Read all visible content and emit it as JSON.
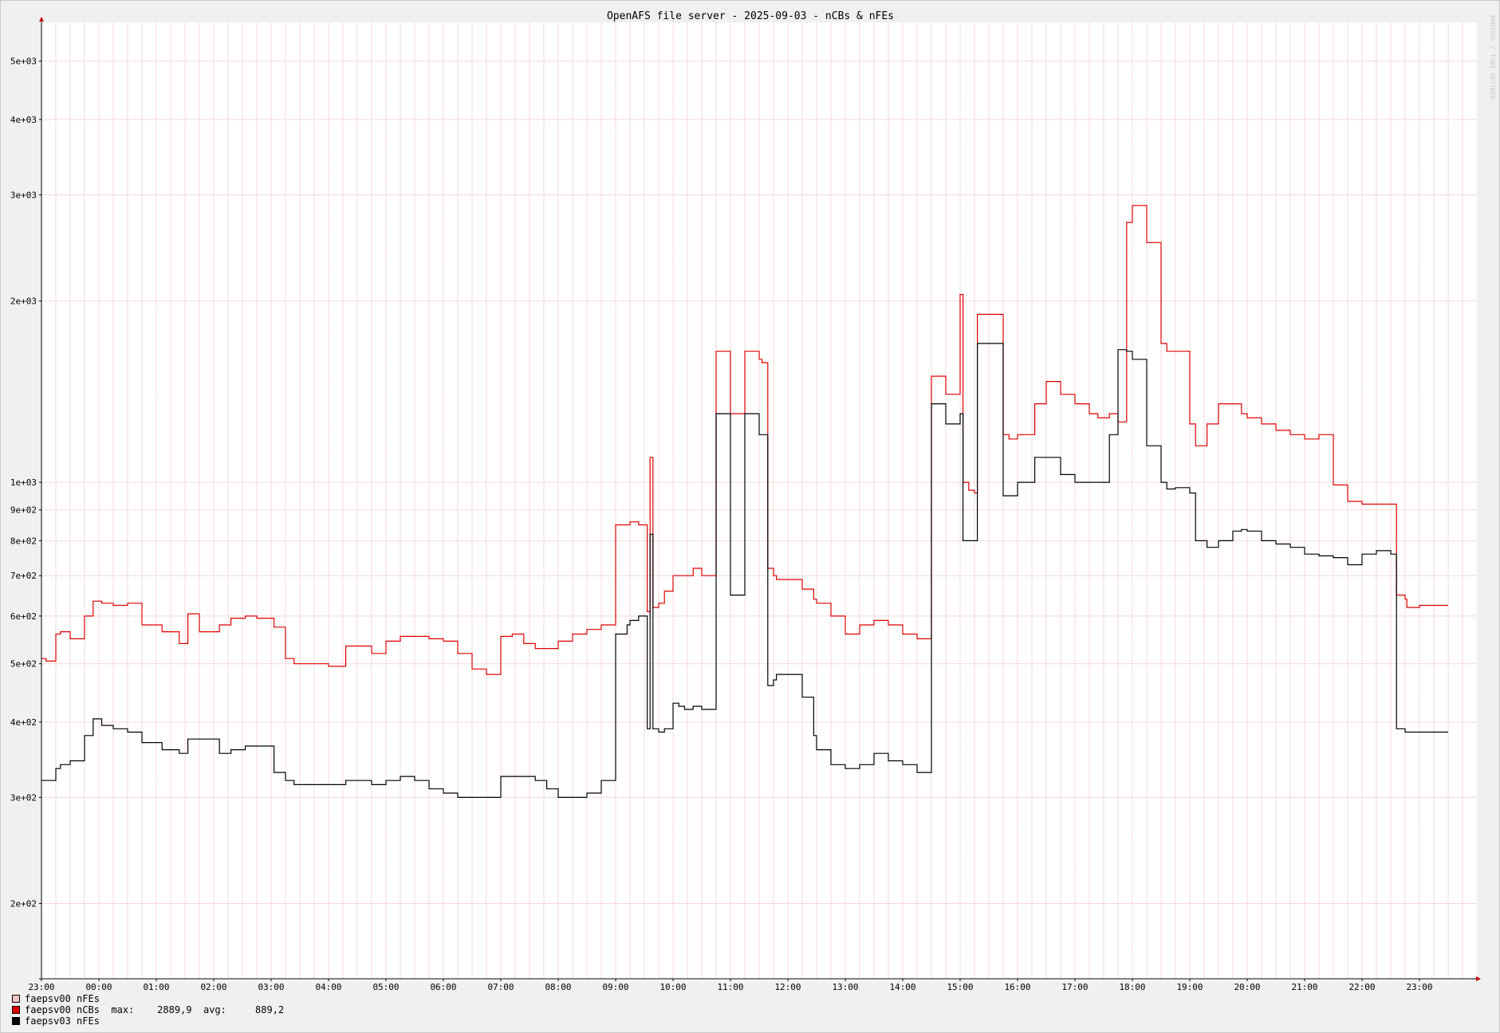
{
  "watermark": "RRDTOOL / TOBI OETIKER",
  "chart_data": {
    "type": "line",
    "title": "OpenAFS file server - 2025-09-03 - nCBs & nFEs",
    "y_scale": "log",
    "ylim": [
      150,
      5800
    ],
    "y_ticks": [
      {
        "value": 200,
        "label": "2e+02"
      },
      {
        "value": 300,
        "label": "3e+02"
      },
      {
        "value": 400,
        "label": "4e+02"
      },
      {
        "value": 500,
        "label": "5e+02"
      },
      {
        "value": 600,
        "label": "6e+02"
      },
      {
        "value": 700,
        "label": "7e+02"
      },
      {
        "value": 800,
        "label": "8e+02"
      },
      {
        "value": 900,
        "label": "9e+02"
      },
      {
        "value": 1000,
        "label": "1e+03"
      },
      {
        "value": 2000,
        "label": "2e+03"
      },
      {
        "value": 3000,
        "label": "3e+03"
      },
      {
        "value": 4000,
        "label": "4e+03"
      },
      {
        "value": 5000,
        "label": "5e+03"
      }
    ],
    "x_unit": "hours from 23:00",
    "xlim": [
      0,
      25
    ],
    "x_ticks": [
      "23:00",
      "00:00",
      "01:00",
      "02:00",
      "03:00",
      "04:00",
      "05:00",
      "06:00",
      "07:00",
      "08:00",
      "09:00",
      "10:00",
      "11:00",
      "12:00",
      "13:00",
      "14:00",
      "15:00",
      "16:00",
      "17:00",
      "18:00",
      "19:00",
      "20:00",
      "21:00",
      "22:00",
      "23:00"
    ],
    "grid": true,
    "legend_position": "bottom-left",
    "series": [
      {
        "name": "faepsv00 nFEs",
        "color": "#f4c4c4",
        "x": [],
        "values": []
      },
      {
        "name": "faepsv00 nCBs",
        "color": "#e00000",
        "stats": {
          "max_label": "max:",
          "max": "2889,9",
          "avg_label": "avg:",
          "avg": "889,2"
        },
        "x": [
          0.0,
          0.08,
          0.25,
          0.33,
          0.5,
          0.75,
          0.9,
          1.05,
          1.25,
          1.5,
          1.75,
          2.1,
          2.4,
          2.55,
          2.75,
          3.1,
          3.3,
          3.55,
          3.75,
          4.05,
          4.25,
          4.4,
          4.75,
          5.0,
          5.3,
          5.55,
          5.75,
          6.0,
          6.25,
          6.5,
          6.75,
          7.0,
          7.25,
          7.5,
          7.75,
          8.0,
          8.2,
          8.4,
          8.6,
          8.8,
          9.0,
          9.25,
          9.5,
          9.75,
          10.0,
          10.2,
          10.25,
          10.4,
          10.55,
          10.6,
          10.65,
          10.75,
          10.85,
          11.0,
          11.1,
          11.2,
          11.35,
          11.5,
          11.75,
          12.0,
          12.25,
          12.5,
          12.55,
          12.65,
          12.75,
          12.8,
          13.0,
          13.25,
          13.45,
          13.5,
          13.75,
          14.0,
          14.25,
          14.5,
          14.75,
          15.0,
          15.25,
          15.5,
          15.75,
          16.0,
          16.05,
          16.15,
          16.25,
          16.3,
          16.35,
          16.5,
          16.75,
          16.85,
          17.0,
          17.3,
          17.5,
          17.75,
          18.0,
          18.25,
          18.4,
          18.6,
          18.75,
          18.9,
          19.0,
          19.25,
          19.5,
          19.6,
          19.75,
          20.0,
          20.1,
          20.3,
          20.5,
          20.75,
          20.9,
          21.0,
          21.25,
          21.5,
          21.75,
          22.0,
          22.25,
          22.5,
          22.75,
          23.0,
          23.25,
          23.5,
          23.6,
          23.75,
          23.78,
          24.0
        ],
        "values": [
          510,
          505,
          560,
          565,
          550,
          600,
          635,
          630,
          625,
          630,
          580,
          565,
          540,
          605,
          565,
          580,
          595,
          600,
          595,
          575,
          510,
          500,
          500,
          495,
          535,
          535,
          520,
          545,
          555,
          555,
          550,
          545,
          520,
          490,
          480,
          555,
          560,
          540,
          530,
          530,
          545,
          560,
          570,
          580,
          850,
          850,
          860,
          850,
          610,
          1100,
          620,
          630,
          660,
          700,
          700,
          700,
          720,
          700,
          1650,
          1300,
          1650,
          1600,
          1580,
          720,
          700,
          690,
          690,
          665,
          640,
          630,
          600,
          560,
          580,
          590,
          580,
          560,
          550,
          1500,
          1400,
          2050,
          1000,
          970,
          960,
          1900,
          1900,
          1900,
          1200,
          1180,
          1200,
          1350,
          1470,
          1400,
          1350,
          1300,
          1280,
          1300,
          1260,
          2700,
          2880,
          2500,
          1700,
          1650,
          1650,
          1250,
          1150,
          1250,
          1350,
          1350,
          1300,
          1280,
          1250,
          1220,
          1200,
          1180,
          1200,
          990,
          930,
          920,
          920,
          920,
          650,
          640,
          620,
          625
        ]
      },
      {
        "name": "faepsv03 nFEs",
        "color": "#000000",
        "x": [
          0.0,
          0.08,
          0.25,
          0.33,
          0.5,
          0.75,
          0.9,
          1.05,
          1.25,
          1.5,
          1.75,
          2.1,
          2.4,
          2.55,
          2.75,
          3.1,
          3.3,
          3.55,
          3.75,
          4.05,
          4.25,
          4.4,
          4.75,
          5.0,
          5.3,
          5.55,
          5.75,
          6.0,
          6.25,
          6.5,
          6.75,
          7.0,
          7.25,
          7.5,
          7.75,
          8.0,
          8.2,
          8.4,
          8.6,
          8.8,
          9.0,
          9.25,
          9.5,
          9.75,
          10.0,
          10.2,
          10.25,
          10.4,
          10.55,
          10.6,
          10.65,
          10.75,
          10.85,
          11.0,
          11.1,
          11.2,
          11.35,
          11.5,
          11.75,
          12.0,
          12.25,
          12.5,
          12.55,
          12.65,
          12.75,
          12.8,
          13.0,
          13.25,
          13.45,
          13.5,
          13.75,
          14.0,
          14.25,
          14.5,
          14.75,
          15.0,
          15.25,
          15.5,
          15.75,
          16.0,
          16.05,
          16.15,
          16.25,
          16.3,
          16.35,
          16.5,
          16.75,
          16.85,
          17.0,
          17.3,
          17.5,
          17.75,
          18.0,
          18.25,
          18.4,
          18.6,
          18.75,
          18.9,
          19.0,
          19.25,
          19.5,
          19.6,
          19.75,
          20.0,
          20.1,
          20.3,
          20.5,
          20.75,
          20.9,
          21.0,
          21.25,
          21.5,
          21.75,
          22.0,
          22.25,
          22.5,
          22.75,
          23.0,
          23.25,
          23.5,
          23.6,
          23.75,
          23.78,
          24.0
        ],
        "values": [
          320,
          320,
          335,
          340,
          345,
          380,
          405,
          395,
          390,
          385,
          370,
          360,
          355,
          375,
          375,
          355,
          360,
          365,
          365,
          330,
          320,
          315,
          315,
          315,
          320,
          320,
          315,
          320,
          325,
          320,
          310,
          305,
          300,
          300,
          300,
          325,
          325,
          325,
          320,
          310,
          300,
          300,
          305,
          320,
          560,
          580,
          590,
          600,
          390,
          820,
          390,
          385,
          390,
          430,
          425,
          420,
          425,
          420,
          1300,
          650,
          1300,
          1200,
          1200,
          460,
          470,
          480,
          480,
          440,
          380,
          360,
          340,
          335,
          340,
          355,
          345,
          340,
          330,
          1350,
          1250,
          1300,
          800,
          800,
          800,
          1700,
          1700,
          1700,
          950,
          950,
          1000,
          1100,
          1100,
          1030,
          1000,
          1000,
          1000,
          1200,
          1660,
          1650,
          1600,
          1150,
          1000,
          975,
          980,
          960,
          800,
          780,
          800,
          830,
          835,
          830,
          800,
          790,
          780,
          760,
          755,
          750,
          730,
          760,
          770,
          760,
          390,
          385,
          385,
          385
        ]
      }
    ]
  }
}
